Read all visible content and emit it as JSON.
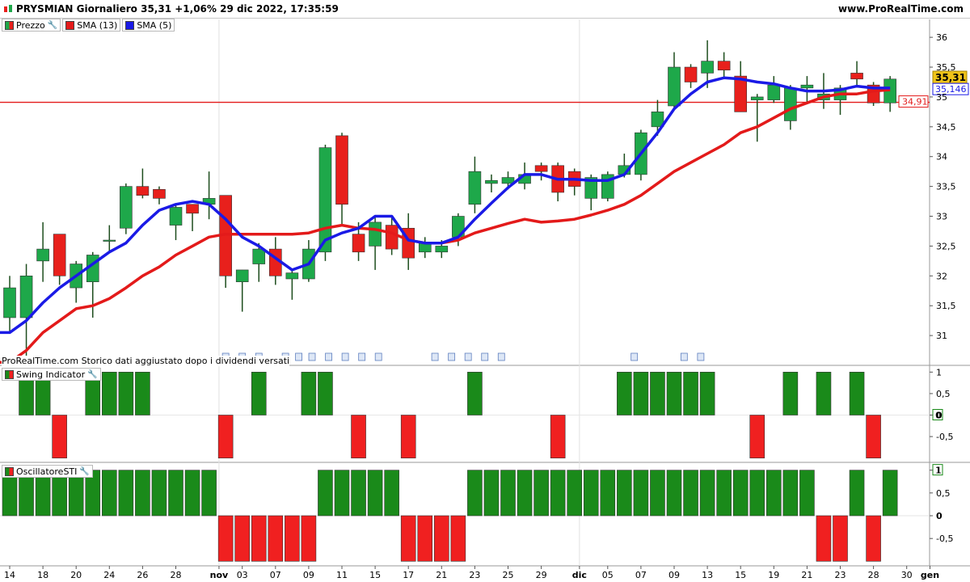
{
  "header": {
    "title": "PRYSMIAN Giornaliero 35,31 +1,06% 29 dic 2022, 17:35:59",
    "site": "www.ProRealTime.com"
  },
  "legend_price": {
    "price_label": "Prezzo",
    "sma13_label": "SMA (13)",
    "sma5_label": "SMA (5)"
  },
  "note": "ProRealTime.com Storico dati aggiustato dopo i dividendi versati",
  "panel_swing": {
    "label": "Swing Indicator"
  },
  "panel_osc": {
    "label": "OscillatoreSTI"
  },
  "colors": {
    "bull": "#1ea84a",
    "bear": "#e8201c",
    "sma13": "#e31a1a",
    "sma5": "#1a1ae6",
    "level_line": "#e31a1a",
    "bar_green": "#1a8a1a",
    "bar_red": "#f02020"
  },
  "chart_data": [
    {
      "type": "candlestick",
      "title": "PRYSMIAN Giornaliero",
      "ylim": [
        30.5,
        36.3
      ],
      "y_ticks": [
        "31",
        "31,5",
        "32",
        "32,5",
        "33",
        "33,5",
        "34",
        "34,5",
        "35",
        "35,5",
        "36"
      ],
      "x_tick_labels": [
        "14",
        "18",
        "20",
        "24",
        "26",
        "28",
        "nov",
        "03",
        "07",
        "09",
        "11",
        "15",
        "17",
        "21",
        "23",
        "25",
        "29",
        "dic",
        "05",
        "07",
        "09",
        "13",
        "15",
        "19",
        "21",
        "23",
        "28",
        "30",
        "gen"
      ],
      "last_price_label": "35,31",
      "sma5_label_value": "35,146",
      "level_label": "34,91",
      "level_value": 34.91,
      "candles": [
        [
          31.3,
          31.8,
          31.05,
          32.0
        ],
        [
          31.3,
          32.0,
          30.6,
          32.2
        ],
        [
          32.25,
          32.45,
          31.9,
          32.9
        ],
        [
          32.7,
          32.0,
          31.85,
          32.7
        ],
        [
          31.8,
          32.2,
          31.55,
          32.25
        ],
        [
          31.9,
          32.35,
          31.3,
          32.4
        ],
        [
          32.6,
          32.6,
          32.4,
          32.85
        ],
        [
          32.8,
          33.5,
          32.7,
          33.55
        ],
        [
          33.5,
          33.35,
          33.3,
          33.8
        ],
        [
          33.45,
          33.3,
          33.2,
          33.5
        ],
        [
          32.85,
          33.15,
          32.6,
          33.2
        ],
        [
          33.2,
          33.05,
          32.75,
          33.2
        ],
        [
          33.2,
          33.3,
          32.95,
          33.75
        ],
        [
          33.35,
          32.0,
          31.8,
          33.35
        ],
        [
          31.9,
          32.1,
          31.4,
          32.1
        ],
        [
          32.2,
          32.45,
          31.9,
          32.55
        ],
        [
          32.45,
          32.0,
          31.85,
          32.65
        ],
        [
          31.95,
          32.05,
          31.6,
          32.1
        ],
        [
          31.95,
          32.45,
          31.9,
          32.6
        ],
        [
          32.4,
          34.15,
          32.25,
          34.2
        ],
        [
          34.35,
          33.2,
          32.85,
          34.4
        ],
        [
          32.7,
          32.4,
          32.25,
          32.9
        ],
        [
          32.5,
          32.9,
          32.1,
          33.0
        ],
        [
          32.85,
          32.45,
          32.35,
          33.0
        ],
        [
          32.8,
          32.3,
          32.1,
          33.05
        ],
        [
          32.4,
          32.55,
          32.3,
          32.65
        ],
        [
          32.4,
          32.5,
          32.3,
          32.6
        ],
        [
          32.65,
          33.0,
          32.5,
          33.05
        ],
        [
          33.2,
          33.75,
          33.05,
          34.0
        ],
        [
          33.55,
          33.6,
          33.4,
          33.7
        ],
        [
          33.55,
          33.65,
          33.45,
          33.75
        ],
        [
          33.55,
          33.7,
          33.45,
          33.9
        ],
        [
          33.85,
          33.75,
          33.6,
          33.9
        ],
        [
          33.85,
          33.4,
          33.25,
          33.9
        ],
        [
          33.75,
          33.5,
          33.35,
          33.8
        ],
        [
          33.3,
          33.65,
          33.1,
          33.7
        ],
        [
          33.3,
          33.7,
          33.25,
          33.75
        ],
        [
          33.7,
          33.85,
          33.65,
          34.05
        ],
        [
          33.7,
          34.4,
          33.6,
          34.45
        ],
        [
          34.5,
          34.75,
          34.35,
          34.95
        ],
        [
          34.85,
          35.5,
          34.8,
          35.75
        ],
        [
          35.5,
          35.25,
          35.15,
          35.55
        ],
        [
          35.4,
          35.6,
          35.15,
          35.95
        ],
        [
          35.6,
          35.45,
          35.3,
          35.75
        ],
        [
          35.35,
          34.75,
          34.75,
          35.6
        ],
        [
          34.95,
          35.0,
          34.25,
          35.05
        ],
        [
          34.95,
          35.2,
          34.9,
          35.35
        ],
        [
          34.6,
          35.15,
          34.45,
          35.2
        ],
        [
          35.15,
          35.2,
          34.9,
          35.35
        ],
        [
          34.95,
          35.05,
          34.8,
          35.4
        ],
        [
          34.95,
          35.15,
          34.7,
          35.2
        ],
        [
          35.4,
          35.3,
          35.2,
          35.6
        ],
        [
          35.2,
          34.9,
          34.85,
          35.25
        ],
        [
          34.9,
          35.3,
          34.75,
          35.35
        ]
      ],
      "sma13": [
        30.55,
        30.75,
        31.05,
        31.25,
        31.45,
        31.5,
        31.62,
        31.8,
        32.0,
        32.15,
        32.35,
        32.5,
        32.65,
        32.7,
        32.7,
        32.7,
        32.7,
        32.7,
        32.72,
        32.8,
        32.85,
        32.8,
        32.78,
        32.72,
        32.6,
        32.55,
        32.55,
        32.6,
        32.72,
        32.8,
        32.88,
        32.95,
        32.9,
        32.92,
        32.95,
        33.02,
        33.1,
        33.2,
        33.35,
        33.55,
        33.75,
        33.9,
        34.05,
        34.2,
        34.4,
        34.5,
        34.65,
        34.8,
        34.9,
        35.0,
        35.05,
        35.05,
        35.1,
        35.12
      ],
      "sma5": [
        31.05,
        31.25,
        31.55,
        31.8,
        32.0,
        32.2,
        32.4,
        32.55,
        32.85,
        33.1,
        33.2,
        33.25,
        33.2,
        32.95,
        32.65,
        32.5,
        32.3,
        32.1,
        32.2,
        32.6,
        32.72,
        32.8,
        33.0,
        33.0,
        32.6,
        32.55,
        32.55,
        32.65,
        32.95,
        33.22,
        33.48,
        33.7,
        33.7,
        33.62,
        33.62,
        33.6,
        33.6,
        33.7,
        34.05,
        34.4,
        34.8,
        35.05,
        35.25,
        35.32,
        35.3,
        35.25,
        35.22,
        35.15,
        35.1,
        35.1,
        35.12,
        35.18,
        35.15,
        35.15
      ]
    },
    {
      "type": "bar",
      "title": "Swing Indicator",
      "ylim": [
        -1.1,
        1.1
      ],
      "y_ticks": [
        "1",
        "0,5",
        "0",
        "-0,5"
      ],
      "last_value_label": "0",
      "values": [
        0,
        1,
        1,
        -1,
        0,
        1,
        1,
        1,
        1,
        0,
        0,
        0,
        0,
        -1,
        0,
        1,
        0,
        0,
        1,
        1,
        0,
        -1,
        0,
        0,
        -1,
        0,
        0,
        0,
        1,
        0,
        0,
        0,
        0,
        -1,
        0,
        0,
        0,
        1,
        1,
        1,
        1,
        1,
        1,
        0,
        0,
        -1,
        0,
        1,
        0,
        1,
        0,
        1,
        -1,
        0
      ]
    },
    {
      "type": "bar",
      "title": "OscillatoreSTI",
      "ylim": [
        -1.1,
        1.1
      ],
      "y_ticks": [
        "1",
        "0,5",
        "0",
        "-0,5"
      ],
      "last_value_label": "1",
      "values": [
        1,
        1,
        1,
        1,
        1,
        1,
        1,
        1,
        1,
        1,
        1,
        1,
        1,
        -1,
        -1,
        -1,
        -1,
        -1,
        -1,
        1,
        1,
        1,
        1,
        1,
        -1,
        -1,
        -1,
        -1,
        1,
        1,
        1,
        1,
        1,
        1,
        1,
        1,
        1,
        1,
        1,
        1,
        1,
        1,
        1,
        1,
        1,
        1,
        1,
        1,
        1,
        -1,
        -1,
        1,
        -1,
        1
      ]
    }
  ]
}
